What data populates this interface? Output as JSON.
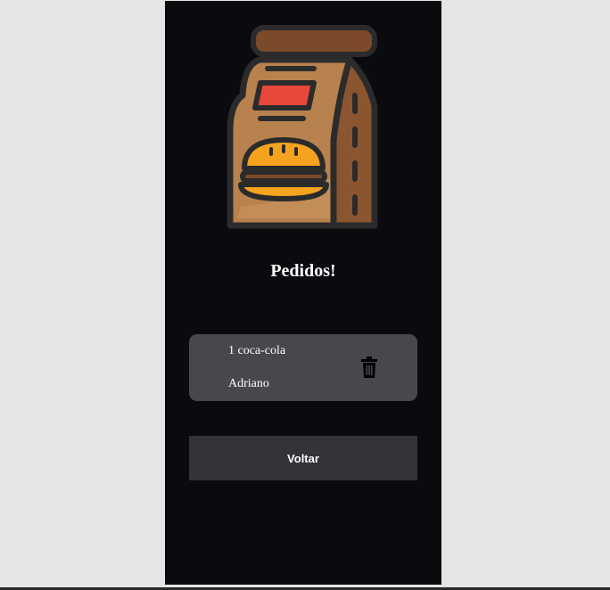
{
  "page": {
    "title": "Pedidos!",
    "logo_icon": "takeaway-burger-bag-icon"
  },
  "orders": [
    {
      "item": "1 coca-cola",
      "customer": "Adriano",
      "delete_icon": "trash-icon"
    }
  ],
  "actions": {
    "back_label": "Voltar"
  },
  "colors": {
    "page_background": "#e5e5e5",
    "panel_background": "#0a0a0f",
    "card_background": "#47474c",
    "button_background": "#333338",
    "text": "#ffffff"
  }
}
